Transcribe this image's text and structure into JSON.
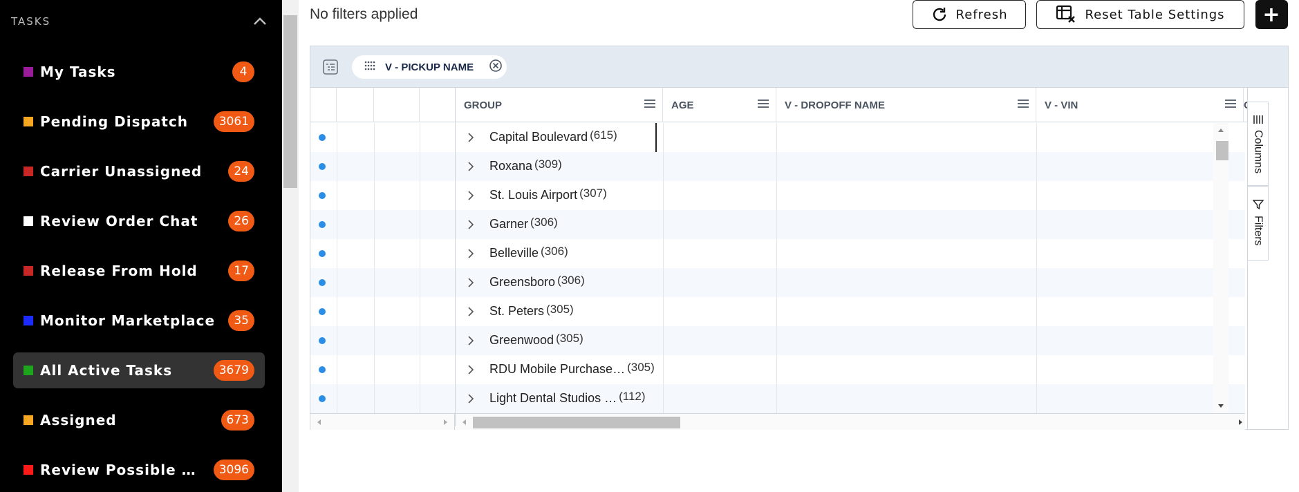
{
  "sidebar": {
    "title": "TASKS",
    "items": [
      {
        "label": "My Tasks",
        "count": "4",
        "color": "#9b1c9b"
      },
      {
        "label": "Pending Dispatch",
        "count": "3061",
        "color": "#f5a623"
      },
      {
        "label": "Carrier Unassigned",
        "count": "24",
        "color": "#c62828"
      },
      {
        "label": "Review Order Chat",
        "count": "26",
        "color": "#ffffff"
      },
      {
        "label": "Release From Hold",
        "count": "17",
        "color": "#c62828"
      },
      {
        "label": "Monitor Marketplace",
        "count": "35",
        "color": "#1e2bff"
      },
      {
        "label": "All Active Tasks",
        "count": "3679",
        "color": "#1ea51e",
        "active": true
      },
      {
        "label": "Assigned",
        "count": "673",
        "color": "#f5a623"
      },
      {
        "label": "Review Possible Du…",
        "count": "3096",
        "color": "#ff1a1a"
      }
    ]
  },
  "toolbar": {
    "filters_status": "No filters applied",
    "refresh_label": "Refresh",
    "reset_label": "Reset Table Settings",
    "add_label": "+"
  },
  "grid": {
    "group_chip": "V - PICKUP NAME",
    "columns": [
      "GROUP",
      "AGE",
      "V - DROPOFF NAME",
      "V - VIN",
      "OP"
    ],
    "rows": [
      {
        "name": "Capital Boulevard",
        "count": "(615)"
      },
      {
        "name": "Roxana",
        "count": "(309)"
      },
      {
        "name": "St. Louis Airport",
        "count": "(307)"
      },
      {
        "name": "Garner",
        "count": "(306)"
      },
      {
        "name": "Belleville",
        "count": "(306)"
      },
      {
        "name": "Greensboro",
        "count": "(306)"
      },
      {
        "name": "St. Peters",
        "count": "(305)"
      },
      {
        "name": "Greenwood",
        "count": "(305)"
      },
      {
        "name": "RDU Mobile Purchase…",
        "count": "(305)"
      },
      {
        "name": "Light Dental Studios …",
        "count": "(112)"
      }
    ],
    "side_tabs": [
      "Columns",
      "Filters"
    ]
  },
  "colors": {
    "badge": "#f05a14",
    "row_dot": "#2a8ee6",
    "group_panel": "#e4eaf1"
  }
}
